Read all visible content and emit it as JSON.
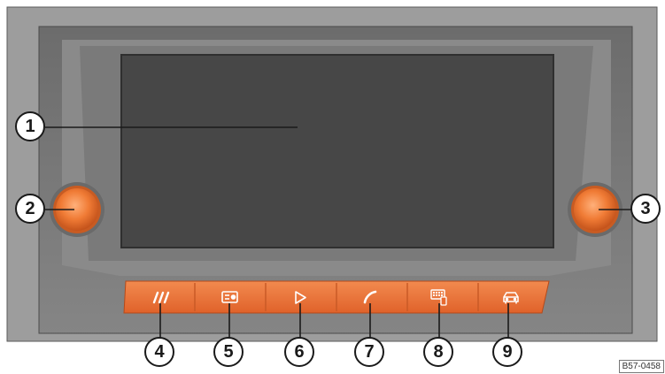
{
  "figure": {
    "reference_code": "B57-0458",
    "callouts": [
      "1",
      "2",
      "3",
      "4",
      "5",
      "6",
      "7",
      "8",
      "9"
    ]
  },
  "unit": {
    "display": {
      "callout": "1"
    },
    "knobs": [
      {
        "id": "left-knob",
        "callout": "2"
      },
      {
        "id": "right-knob",
        "callout": "3"
      }
    ],
    "buttons": [
      {
        "id": "menu-button",
        "icon": "three-slashes-icon",
        "callout": "4"
      },
      {
        "id": "radio-button",
        "icon": "radio-icon",
        "callout": "5"
      },
      {
        "id": "media-button",
        "icon": "play-icon",
        "callout": "6"
      },
      {
        "id": "phone-button",
        "icon": "phone-handset-icon",
        "callout": "7"
      },
      {
        "id": "app-connect-button",
        "icon": "keyboard-phone-icon",
        "callout": "8"
      },
      {
        "id": "car-button",
        "icon": "car-icon",
        "callout": "9"
      }
    ]
  },
  "colors": {
    "frame_outer": "#9d9d9d",
    "frame_inner": "#7d7d7d",
    "screen": "#474747",
    "button_orange": "#ea6f34",
    "knob_orange": "#f07b35",
    "icon_white": "#ffffff",
    "callout_stroke": "#1a1a1a"
  }
}
